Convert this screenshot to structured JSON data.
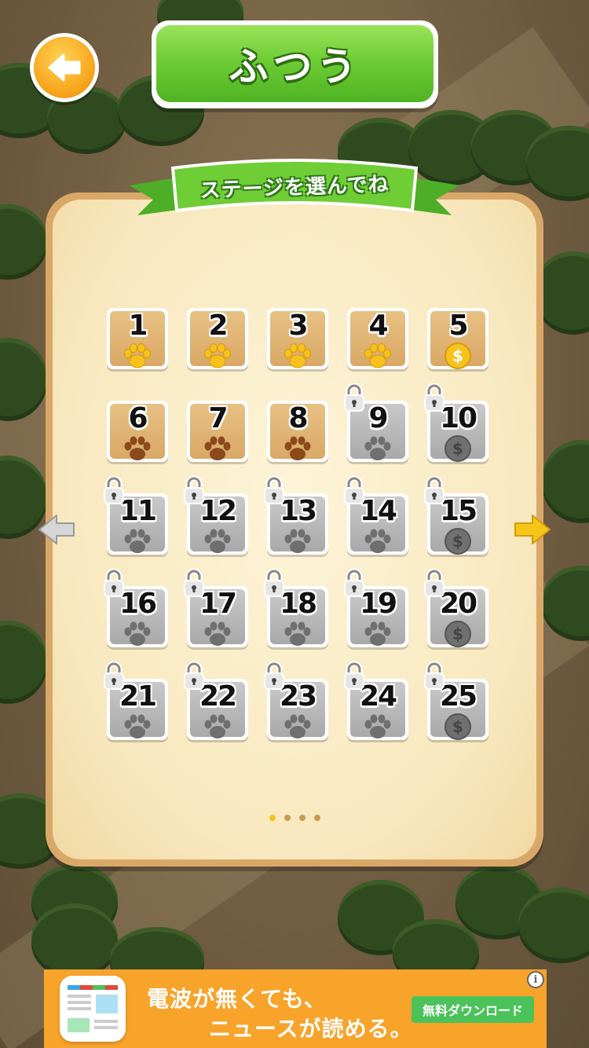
{
  "header": {
    "back_icon": "back-arrow-icon",
    "title": "ふつう"
  },
  "ribbon": {
    "text": "ステージを選んでね"
  },
  "stages": [
    {
      "n": "1",
      "state": "open",
      "badge": "paw-gold"
    },
    {
      "n": "2",
      "state": "open",
      "badge": "paw-gold"
    },
    {
      "n": "3",
      "state": "open",
      "badge": "paw-gold"
    },
    {
      "n": "4",
      "state": "open",
      "badge": "paw-gold"
    },
    {
      "n": "5",
      "state": "open",
      "badge": "coin-gold"
    },
    {
      "n": "6",
      "state": "open",
      "badge": "paw-brown"
    },
    {
      "n": "7",
      "state": "open",
      "badge": "paw-brown"
    },
    {
      "n": "8",
      "state": "open",
      "badge": "paw-brown"
    },
    {
      "n": "9",
      "state": "locked",
      "badge": "paw-gray"
    },
    {
      "n": "10",
      "state": "locked",
      "badge": "coin-gray"
    },
    {
      "n": "11",
      "state": "locked",
      "badge": "paw-gray"
    },
    {
      "n": "12",
      "state": "locked",
      "badge": "paw-gray"
    },
    {
      "n": "13",
      "state": "locked",
      "badge": "paw-gray"
    },
    {
      "n": "14",
      "state": "locked",
      "badge": "paw-gray"
    },
    {
      "n": "15",
      "state": "locked",
      "badge": "coin-gray"
    },
    {
      "n": "16",
      "state": "locked",
      "badge": "paw-gray"
    },
    {
      "n": "17",
      "state": "locked",
      "badge": "paw-gray"
    },
    {
      "n": "18",
      "state": "locked",
      "badge": "paw-gray"
    },
    {
      "n": "19",
      "state": "locked",
      "badge": "paw-gray"
    },
    {
      "n": "20",
      "state": "locked",
      "badge": "coin-gray"
    },
    {
      "n": "21",
      "state": "locked",
      "badge": "paw-gray"
    },
    {
      "n": "22",
      "state": "locked",
      "badge": "paw-gray"
    },
    {
      "n": "23",
      "state": "locked",
      "badge": "paw-gray"
    },
    {
      "n": "24",
      "state": "locked",
      "badge": "paw-gray"
    },
    {
      "n": "25",
      "state": "locked",
      "badge": "coin-gray"
    }
  ],
  "pager": {
    "pages": 4,
    "current": 1
  },
  "nav": {
    "prev_icon": "left-arrow-icon",
    "next_icon": "right-arrow-icon"
  },
  "ad": {
    "line1": "電波が無くても、",
    "line2": "ニュースが読める。",
    "button": "無料ダウンロード",
    "info": "i"
  },
  "colors": {
    "title_green": "#6fcd35",
    "ribbon_green": "#5cc232",
    "back_orange": "#f8a51c",
    "ad_orange": "#f8a32a",
    "ad_button_green": "#4cc25a",
    "next_arrow_yellow": "#f5c518"
  }
}
